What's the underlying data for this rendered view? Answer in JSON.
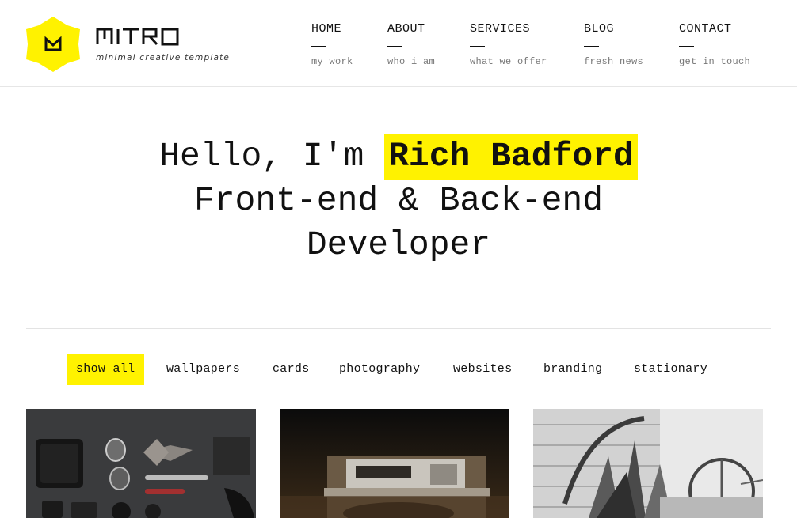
{
  "brand": {
    "name": "MITRO",
    "tagline": "minimal creative template",
    "accent_color": "#fff200",
    "logo_icon": "crown-hexagon-icon"
  },
  "nav": {
    "items": [
      {
        "label": "HOME",
        "sub": "my work"
      },
      {
        "label": "ABOUT",
        "sub": "who i am"
      },
      {
        "label": "SERVICES",
        "sub": "what we offer"
      },
      {
        "label": "BLOG",
        "sub": "fresh news"
      },
      {
        "label": "CONTACT",
        "sub": "get in touch"
      }
    ]
  },
  "hero": {
    "greeting": "Hello, I'm",
    "name": "Rich Badford",
    "line2": "Front-end & Back-end",
    "line3": "Developer"
  },
  "filters": {
    "items": [
      "show all",
      "wallpapers",
      "cards",
      "photography",
      "websites",
      "branding",
      "stationary"
    ],
    "active": "show all"
  },
  "gallery": {
    "items": [
      {
        "alt": "flat-lay accessories photo"
      },
      {
        "alt": "vintage camera photo"
      },
      {
        "alt": "rustic wood sculpture photo"
      }
    ]
  }
}
